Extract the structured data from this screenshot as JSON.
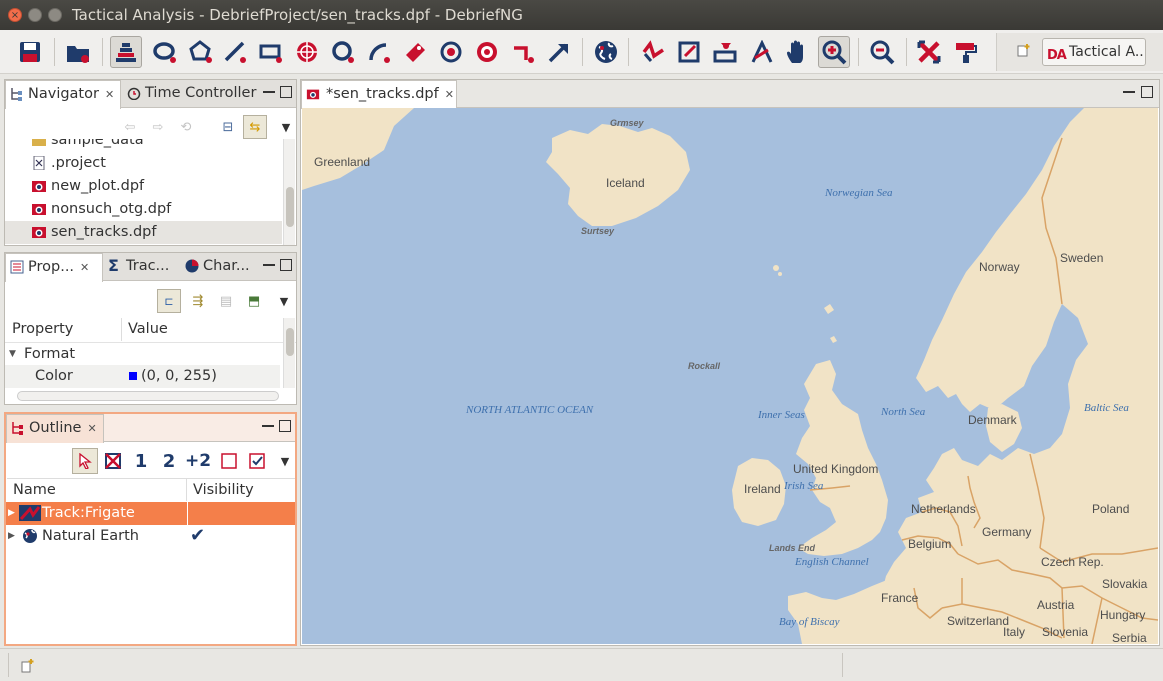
{
  "window": {
    "title": "Tactical Analysis - DebriefProject/sen_tracks.dpf - DebriefNG"
  },
  "toolbar": {
    "buttons": [
      "save-icon",
      "new-plot-icon",
      "layers-icon",
      "ellipse-icon",
      "polygon-icon",
      "line-icon",
      "rectangle-icon",
      "range-rings-icon",
      "circle-icon",
      "arc-icon",
      "label-icon",
      "bearing-icon",
      "target-icon",
      "vector-icon",
      "arrow-icon",
      "globe-icon",
      "drag-segment-icon",
      "drag-point-icon",
      "drag-feature-icon",
      "measure-icon",
      "pan-icon",
      "zoom-in-icon",
      "zoom-out-icon",
      "fit-icon",
      "paint-icon"
    ],
    "perspective_label": "Tactical A...",
    "perspective_logo": "DA",
    "accent": "#c8102e",
    "icon_color": "#1f3b6b"
  },
  "navigator": {
    "tabs": [
      {
        "label": "Navigator"
      },
      {
        "label": "Time Controller"
      }
    ],
    "files": [
      {
        "name": "sample_data",
        "icon": "folder-icon"
      },
      {
        "name": ".project",
        "icon": "xml-file-icon"
      },
      {
        "name": "new_plot.dpf",
        "icon": "plot-file-icon"
      },
      {
        "name": "nonsuch_otg.dpf",
        "icon": "plot-file-icon"
      },
      {
        "name": "sen_tracks.dpf",
        "icon": "plot-file-icon",
        "selected": true
      }
    ]
  },
  "properties": {
    "tabs": [
      {
        "label": "Prop..."
      },
      {
        "label": "Trac..."
      },
      {
        "label": "Char..."
      }
    ],
    "columns": [
      "Property",
      "Value"
    ],
    "category": "Format",
    "rows": [
      {
        "property": "Color",
        "value": "(0, 0, 255)",
        "swatch": "#0000ff"
      }
    ]
  },
  "outline": {
    "tab": "Outline",
    "toolbar_labels": [
      "1",
      "2",
      "+2"
    ],
    "columns": [
      "Name",
      "Visibility"
    ],
    "items": [
      {
        "name": "Track:Frigate",
        "visible": false,
        "selected": true
      },
      {
        "name": "Natural Earth",
        "visible": true,
        "selected": false
      }
    ],
    "selection_color": "#f47f4a"
  },
  "editor": {
    "tab": "*sen_tracks.dpf",
    "map": {
      "sea_color": "#a6bfdd",
      "land_color": "#f1e3c6",
      "border_color": "#d9a366",
      "countries": [
        "Greenland",
        "Iceland",
        "Norway",
        "Sweden",
        "Denmark",
        "United Kingdom",
        "Ireland",
        "Netherlands",
        "Germany",
        "Belgium",
        "Poland",
        "France",
        "Czech Rep.",
        "Slovakia",
        "Austria",
        "Hungary",
        "Switzerland",
        "Italy",
        "Slovenia",
        "Serbia"
      ],
      "seas": [
        "Norwegian Sea",
        "NORTH ATLANTIC OCEAN",
        "Inner Seas",
        "North Sea",
        "Baltic Sea",
        "Irish Sea",
        "English Channel",
        "Bay of Biscay"
      ],
      "islands": [
        "Grmsey",
        "Surtsey",
        "Rockall",
        "Lands End"
      ]
    }
  }
}
